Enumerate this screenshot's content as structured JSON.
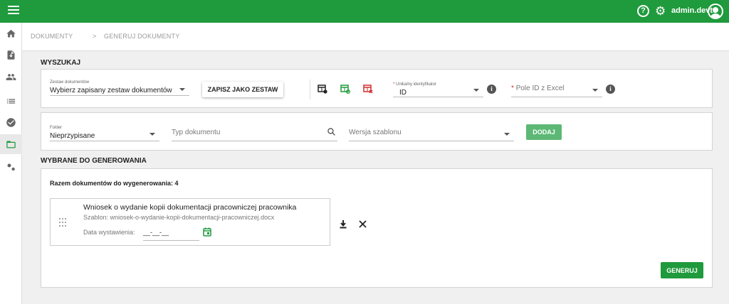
{
  "header": {
    "user_name": "admin.devtc"
  },
  "breadcrumb": [
    "DOKUMENTY",
    ">",
    "GENERUJ DOKUMENTY"
  ],
  "search": {
    "title": "WYSZUKAJ",
    "set_label": "Zestaw dokumentów",
    "set_value": "Wybierz zapisany zestaw dokumentów",
    "save_set_label": "ZAPISZ JAKO ZESTAW",
    "unique_id_label": "Unikalny identyfikator",
    "unique_id_value": "ID",
    "excel_id_placeholder": "Pole ID z Excel",
    "required_mark": "*",
    "info_glyph": "i",
    "folder_label": "Folder",
    "folder_value": "Nieprzypisane",
    "doc_type_placeholder": "Typ dokumentu",
    "template_version_placeholder": "Wersja szablonu",
    "add_label": "DODAJ"
  },
  "selected": {
    "title": "WYBRANE DO GENEROWANIA",
    "total_text": "Razem dokumentów do wygenerowania: 4",
    "documents": [
      {
        "name": "Wniosek o wydanie kopii dokumentacji pracowniczej pracownika",
        "template": "Szablon: wniosek-o-wydanie-kopii-dokumentacji-pracowniczej.docx",
        "date_label": "Data wystawienia:",
        "date_value": "__-__-__"
      }
    ],
    "generate_label": "GENERUJ"
  },
  "icons": {
    "menu": "menu-icon",
    "help": "help-icon",
    "settings": "gear-icon",
    "account": "account-icon",
    "sidebar": [
      "home-icon",
      "document-icon",
      "people-icon",
      "list-icon",
      "check-circle-icon",
      "folder-open-icon",
      "settings-cog-icon"
    ],
    "toolbar": [
      "table-settings-icon",
      "table-refresh-icon",
      "table-remove-icon"
    ],
    "search": "search-icon",
    "calendar": "calendar-icon",
    "download": "download-icon",
    "close": "close-icon",
    "drag": "drag-handle-icon"
  },
  "colors": {
    "brand": "#1f9a3c",
    "add_button": "#5cb874",
    "remove_red": "#d32f2f"
  }
}
